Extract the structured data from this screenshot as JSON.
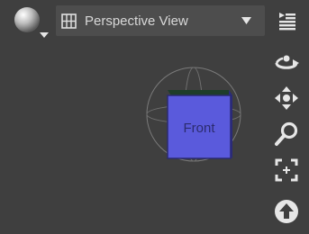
{
  "toolbar": {
    "view_dropdown": {
      "selected": "Perspective View"
    }
  },
  "icons": {
    "shading": "sphere-shading-icon",
    "view_layout": "grid-layout-icon",
    "dropdown": "dropdown-caret-icon",
    "menu": "pane-menu-icon",
    "orbit": "orbit-icon",
    "pan": "pan-icon",
    "zoom": "zoom-icon",
    "frame": "frame-icon",
    "up": "up-arrow-icon"
  },
  "view_cube": {
    "face_label": "Front"
  },
  "colors": {
    "background": "#3f3f3f",
    "dropdown_bg": "#4d4d4d",
    "cube_face": "#5a5adc",
    "cube_edge": "#1e3d2a",
    "icon": "#e6e6e6"
  }
}
